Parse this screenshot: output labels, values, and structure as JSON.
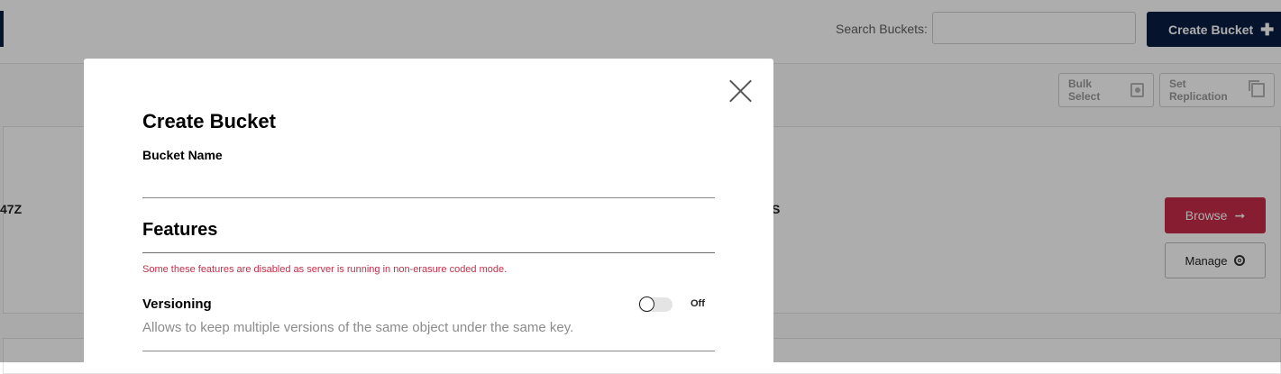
{
  "header": {
    "search_label": "Search Buckets:",
    "search_placeholder": "",
    "create_bucket_label": "Create Bucket"
  },
  "toolbar": {
    "bulk_select_label": "Bulk Select",
    "set_replication_label": "Set Replication"
  },
  "bucket_card": {
    "left_text_partial": "47Z",
    "right_text_partial": "ECTS",
    "browse_label": "Browse",
    "manage_label": "Manage"
  },
  "modal": {
    "title": "Create Bucket",
    "bucket_name_label": "Bucket Name",
    "bucket_name_value": "",
    "features_title": "Features",
    "warning_text": "Some these features are disabled as server is running in non-erasure coded mode.",
    "versioning": {
      "label": "Versioning",
      "state": "Off",
      "enabled": false,
      "description": "Allows to keep multiple versions of the same object under the same key."
    }
  },
  "colors": {
    "navy": "#081c42",
    "accent_red": "#c72c48"
  }
}
